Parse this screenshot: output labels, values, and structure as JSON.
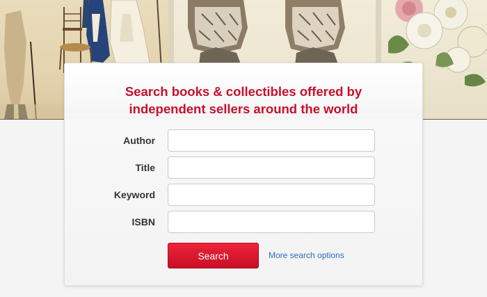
{
  "banner": {
    "prints": [
      {
        "name": "vintage-fashion-plate"
      },
      {
        "name": "vintage-owl-plate"
      },
      {
        "name": "vintage-flower-plate"
      }
    ],
    "colors": {
      "paper": "#efe9d8",
      "frame": "#ddd4c0"
    }
  },
  "search": {
    "heading_line1": "Search books & collectibles offered by",
    "heading_line2": "independent sellers around the world",
    "fields": {
      "author": {
        "label": "Author",
        "value": "",
        "placeholder": ""
      },
      "title": {
        "label": "Title",
        "value": "",
        "placeholder": ""
      },
      "keyword": {
        "label": "Keyword",
        "value": "",
        "placeholder": ""
      },
      "isbn": {
        "label": "ISBN",
        "value": "",
        "placeholder": ""
      }
    },
    "submit_label": "Search",
    "more_options_label": "More search options",
    "colors": {
      "accent": "#c8102e",
      "link": "#2a6ebb",
      "button": "#dc1a30"
    }
  }
}
